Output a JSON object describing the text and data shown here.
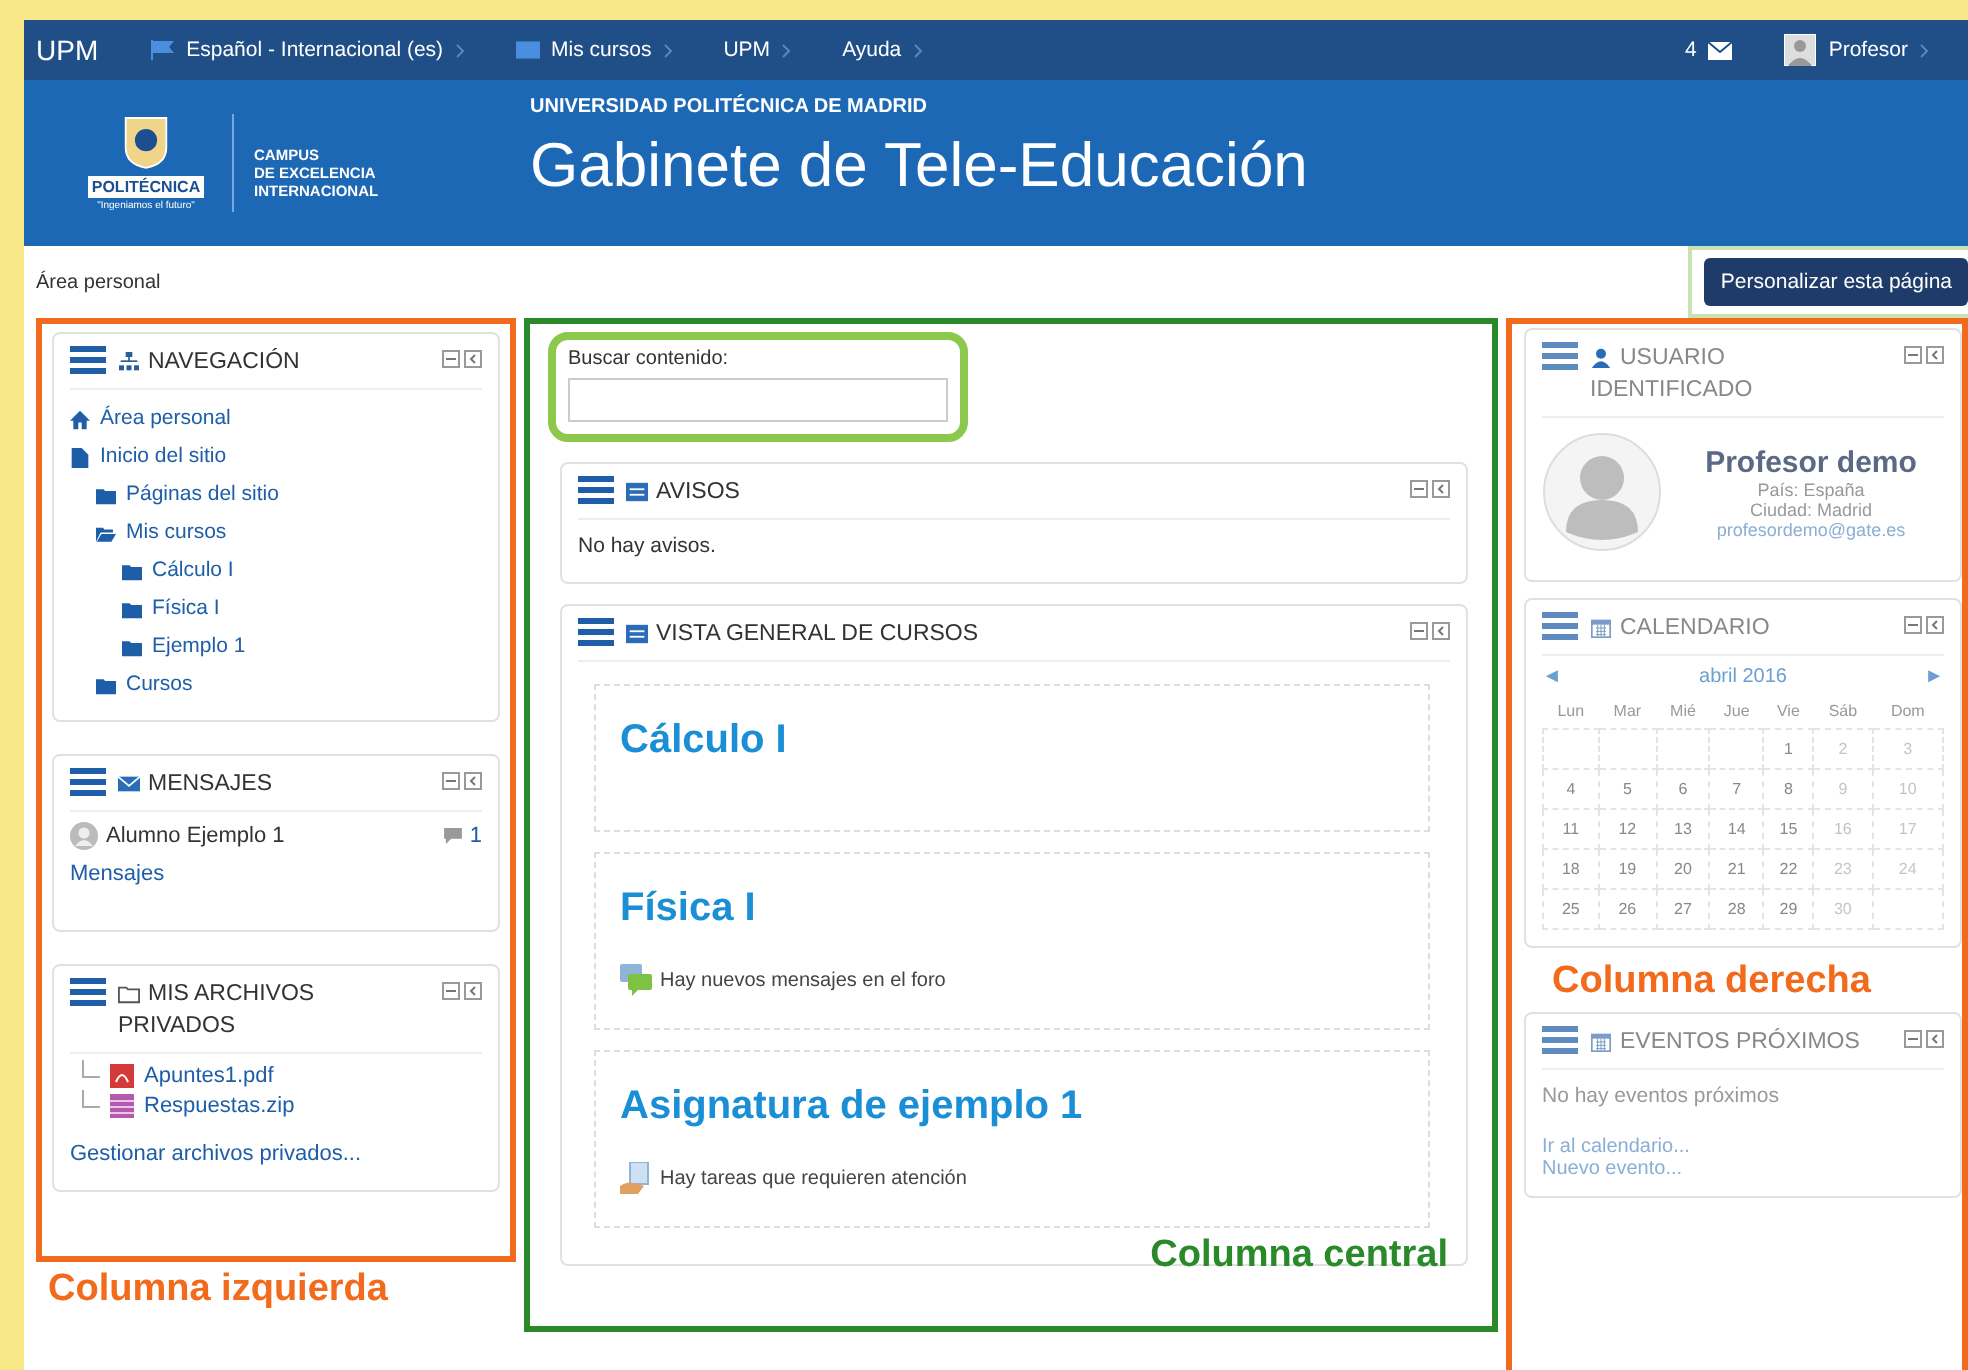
{
  "navbar": {
    "brand": "UPM",
    "items": [
      {
        "kind": "flag",
        "label": "Español - Internacional (es)"
      },
      {
        "kind": "courses",
        "label": "Mis cursos"
      },
      {
        "kind": "plain",
        "label": "UPM"
      },
      {
        "kind": "plain",
        "label": "Ayuda"
      }
    ],
    "messages_count": "4",
    "user": "Profesor"
  },
  "header": {
    "logo_label": "POLITÉCNICA",
    "logo_motto": "\"Ingeniamos el futuro\"",
    "campus_lines": [
      "CAMPUS",
      "DE EXCELENCIA",
      "INTERNACIONAL"
    ],
    "university": "UNIVERSIDAD POLITÉCNICA DE MADRID",
    "title": "Gabinete de Tele-Educación"
  },
  "breadcrumb": "Área personal",
  "customize_button": "Personalizar esta página",
  "left_column": {
    "annotation": {
      "label": "Columna izquierda",
      "color": "#f26a1b"
    },
    "blocks": [
      {
        "kind": "navigation",
        "title": "NAVEGACIÓN",
        "tree": [
          {
            "kind": "home",
            "label": "Área personal"
          },
          {
            "kind": "page",
            "label": "Inicio del sitio",
            "children": [
              {
                "kind": "folder",
                "label": "Páginas del sitio"
              },
              {
                "kind": "folder-open",
                "label": "Mis cursos",
                "children": [
                  {
                    "kind": "folder",
                    "label": "Cálculo I"
                  },
                  {
                    "kind": "folder",
                    "label": "Física I"
                  },
                  {
                    "kind": "folder",
                    "label": "Ejemplo 1"
                  }
                ]
              },
              {
                "kind": "folder",
                "label": "Cursos"
              }
            ]
          }
        ]
      },
      {
        "kind": "messages",
        "title": "MENSAJES",
        "contacts": [
          {
            "name": "Alumno Ejemplo 1",
            "count": "1"
          }
        ],
        "link": "Mensajes"
      },
      {
        "kind": "files",
        "title": "MIS ARCHIVOS PRIVADOS",
        "files": [
          {
            "kind": "pdf",
            "name": "Apuntes1.pdf"
          },
          {
            "kind": "zip",
            "name": "Respuestas.zip"
          }
        ],
        "link": "Gestionar archivos privados..."
      }
    ]
  },
  "center_column": {
    "annotation": {
      "label": "Columna central",
      "color": "#2a8a2a"
    },
    "search": {
      "label": "Buscar contenido:"
    },
    "blocks": [
      {
        "kind": "news",
        "title": "AVISOS",
        "text": "No hay avisos."
      },
      {
        "kind": "courses",
        "title": "VISTA GENERAL DE CURSOS",
        "courses": [
          {
            "title": "Cálculo I"
          },
          {
            "title": "Física I",
            "notice": {
              "kind": "forum",
              "text": "Hay nuevos mensajes en el foro"
            }
          },
          {
            "title": "Asignatura de ejemplo 1",
            "notice": {
              "kind": "assignment",
              "text": "Hay tareas que requieren atención"
            }
          }
        ]
      }
    ]
  },
  "right_column": {
    "annotation": {
      "label": "Columna derecha",
      "color": "#f26a1b"
    },
    "blocks": [
      {
        "kind": "user",
        "title": "USUARIO IDENTIFICADO",
        "name": "Profesor demo",
        "lines": [
          "País: España",
          "Ciudad: Madrid"
        ],
        "email": "profesordemo@gate.es"
      },
      {
        "kind": "calendar",
        "title": "CALENDARIO",
        "prev": "◄",
        "month": "abril 2016",
        "next": "►",
        "weekdays": [
          "Lun",
          "Mar",
          "Mié",
          "Jue",
          "Vie",
          "Sáb",
          "Dom"
        ],
        "weeks": [
          [
            "1",
            "2",
            "3"
          ],
          [
            "4",
            "5",
            "6",
            "7",
            "8",
            "9",
            "10"
          ],
          [
            "11",
            "12",
            "13",
            "14",
            "15",
            "16",
            "17"
          ],
          [
            "18",
            "19",
            "20",
            "21",
            "22",
            "23",
            "24"
          ],
          [
            "25",
            "26",
            "27",
            "28",
            "29",
            "30"
          ]
        ]
      },
      {
        "kind": "events",
        "title": "EVENTOS PRÓXIMOS",
        "text": "No hay eventos próximos",
        "links": [
          "Ir al calendario...",
          "Nuevo evento..."
        ]
      }
    ]
  }
}
